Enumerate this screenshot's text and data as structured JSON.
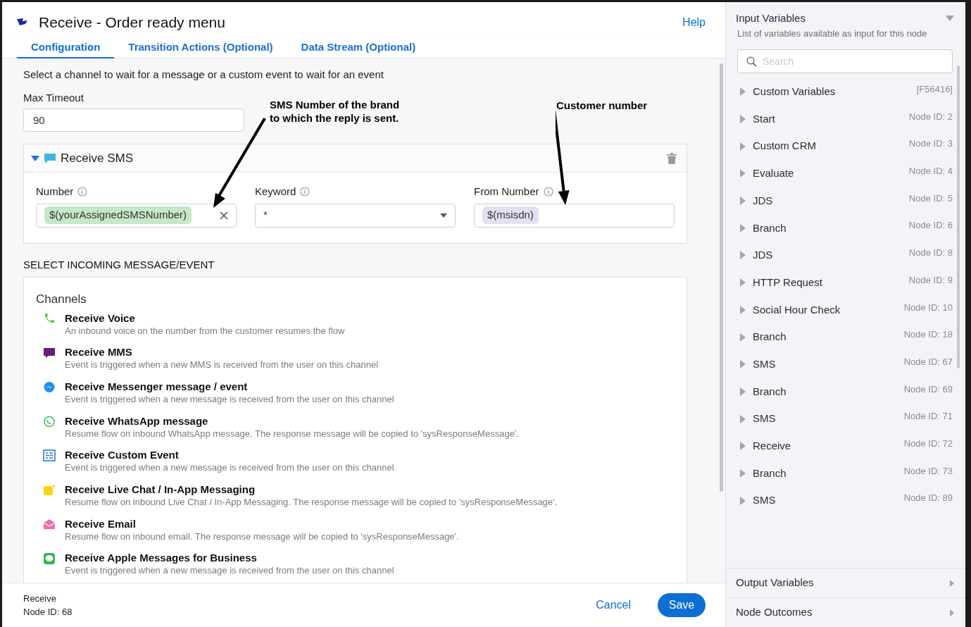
{
  "window": {
    "title": "Receive - Order ready menu",
    "help": "Help"
  },
  "tabs": [
    {
      "label": "Configuration",
      "selected": true
    },
    {
      "label": "Transition Actions (Optional)",
      "selected": false
    },
    {
      "label": "Data Stream (Optional)",
      "selected": false
    }
  ],
  "intro": "Select a channel to wait for a message or a custom event to wait for an event",
  "max_timeout": {
    "label": "Max Timeout",
    "value": "90"
  },
  "annotations": [
    {
      "text": "SMS Number of the brand to which the reply is sent."
    },
    {
      "text": "Customer number"
    }
  ],
  "receive_sms": {
    "title": "Receive SMS",
    "expanded": true,
    "fields": [
      {
        "kind": "chip",
        "label": "Number",
        "value": "$(yourAssignedSMSNumber)",
        "color": "#c5e8c9"
      },
      {
        "kind": "select",
        "label": "Keyword",
        "value": "*"
      },
      {
        "kind": "chip",
        "label": "From Number",
        "value": "$(msisdn)",
        "color": "#e1e1f3"
      }
    ]
  },
  "section_title": "SELECT INCOMING MESSAGE/EVENT",
  "channels_title": "Channels",
  "channels": [
    {
      "kind": "voice",
      "title": "Receive Voice",
      "description": "An inbound voice on the number from the customer resumes the flow"
    },
    {
      "kind": "mms",
      "title": "Receive MMS",
      "description": "Event is triggered when a new MMS is received from the user on this channel"
    },
    {
      "kind": "messenger",
      "title": "Receive Messenger message / event",
      "description": "Event is triggered when a new message is received from the user on this channel"
    },
    {
      "kind": "whatsapp",
      "title": "Receive WhatsApp message",
      "description": "Resume flow on inbound WhatsApp message. The response message will be copied to 'sysResponseMessage'."
    },
    {
      "kind": "custom",
      "title": "Receive Custom Event",
      "description": "Event is triggered when a new message is received from the user on this channel"
    },
    {
      "kind": "livechat",
      "title": "Receive Live Chat / In-App Messaging",
      "description": "Resume flow on inbound Live Chat / In-App Messaging. The response message will be copied to 'sysResponseMessage'."
    },
    {
      "kind": "email",
      "title": "Receive Email",
      "description": "Resume flow on inbound email. The response message will be copied to 'sysResponseMessage'."
    },
    {
      "kind": "apple",
      "title": "Receive Apple Messages for Business",
      "description": "Event is triggered when a new message is received from the user on this channel"
    }
  ],
  "footer": {
    "node_name": "Receive",
    "node_id": "Node ID: 68",
    "cancel": "Cancel",
    "save": "Save"
  },
  "sidebar": {
    "title": "Input Variables",
    "subtitle": "List of variables available as input for this node",
    "search_placeholder": "Search",
    "items": [
      {
        "label": "Custom Variables",
        "meta": "[F56416]",
        "expanded": false
      },
      {
        "label": "Start",
        "meta": "Node ID: 2",
        "expanded": false
      },
      {
        "label": "Custom CRM",
        "meta": "Node ID: 3",
        "expanded": false
      },
      {
        "label": "Evaluate",
        "meta": "Node ID: 4",
        "expanded": false
      },
      {
        "label": "JDS",
        "meta": "Node ID: 5",
        "expanded": false
      },
      {
        "label": "Branch",
        "meta": "Node ID: 6",
        "expanded": false
      },
      {
        "label": "JDS",
        "meta": "Node ID: 8",
        "expanded": false
      },
      {
        "label": "HTTP Request",
        "meta": "Node ID: 9",
        "expanded": false
      },
      {
        "label": "Social Hour Check",
        "meta": "Node ID: 10",
        "expanded": false
      },
      {
        "label": "Branch",
        "meta": "Node ID: 18",
        "expanded": false
      },
      {
        "label": "SMS",
        "meta": "Node ID: 67",
        "expanded": false
      },
      {
        "label": "Branch",
        "meta": "Node ID: 69",
        "expanded": false
      },
      {
        "label": "SMS",
        "meta": "Node ID: 71",
        "expanded": false
      },
      {
        "label": "Receive",
        "meta": "Node ID: 72",
        "expanded": false
      },
      {
        "label": "Branch",
        "meta": "Node ID: 73",
        "expanded": false
      },
      {
        "label": "SMS",
        "meta": "Node ID: 89",
        "expanded": false
      }
    ],
    "sections": [
      {
        "label": "Output Variables"
      },
      {
        "label": "Node Outcomes"
      }
    ]
  }
}
